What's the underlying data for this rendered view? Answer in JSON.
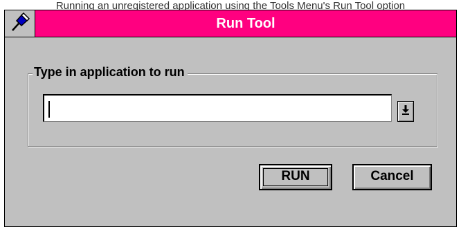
{
  "caption": "Running an unregistered application using the Tools Menu's Run Tool option",
  "window": {
    "title": "Run Tool",
    "system_menu_icon": "pushpin-icon"
  },
  "group": {
    "label": "Type in application to run"
  },
  "combo": {
    "value": "",
    "dropdown_icon": "down-arrow-icon"
  },
  "buttons": {
    "run_label": "RUN",
    "cancel_label": "Cancel"
  },
  "colors": {
    "titlebar": "#ff0080",
    "dialog_face": "#c0c0c0",
    "title_text": "#ffffff"
  }
}
